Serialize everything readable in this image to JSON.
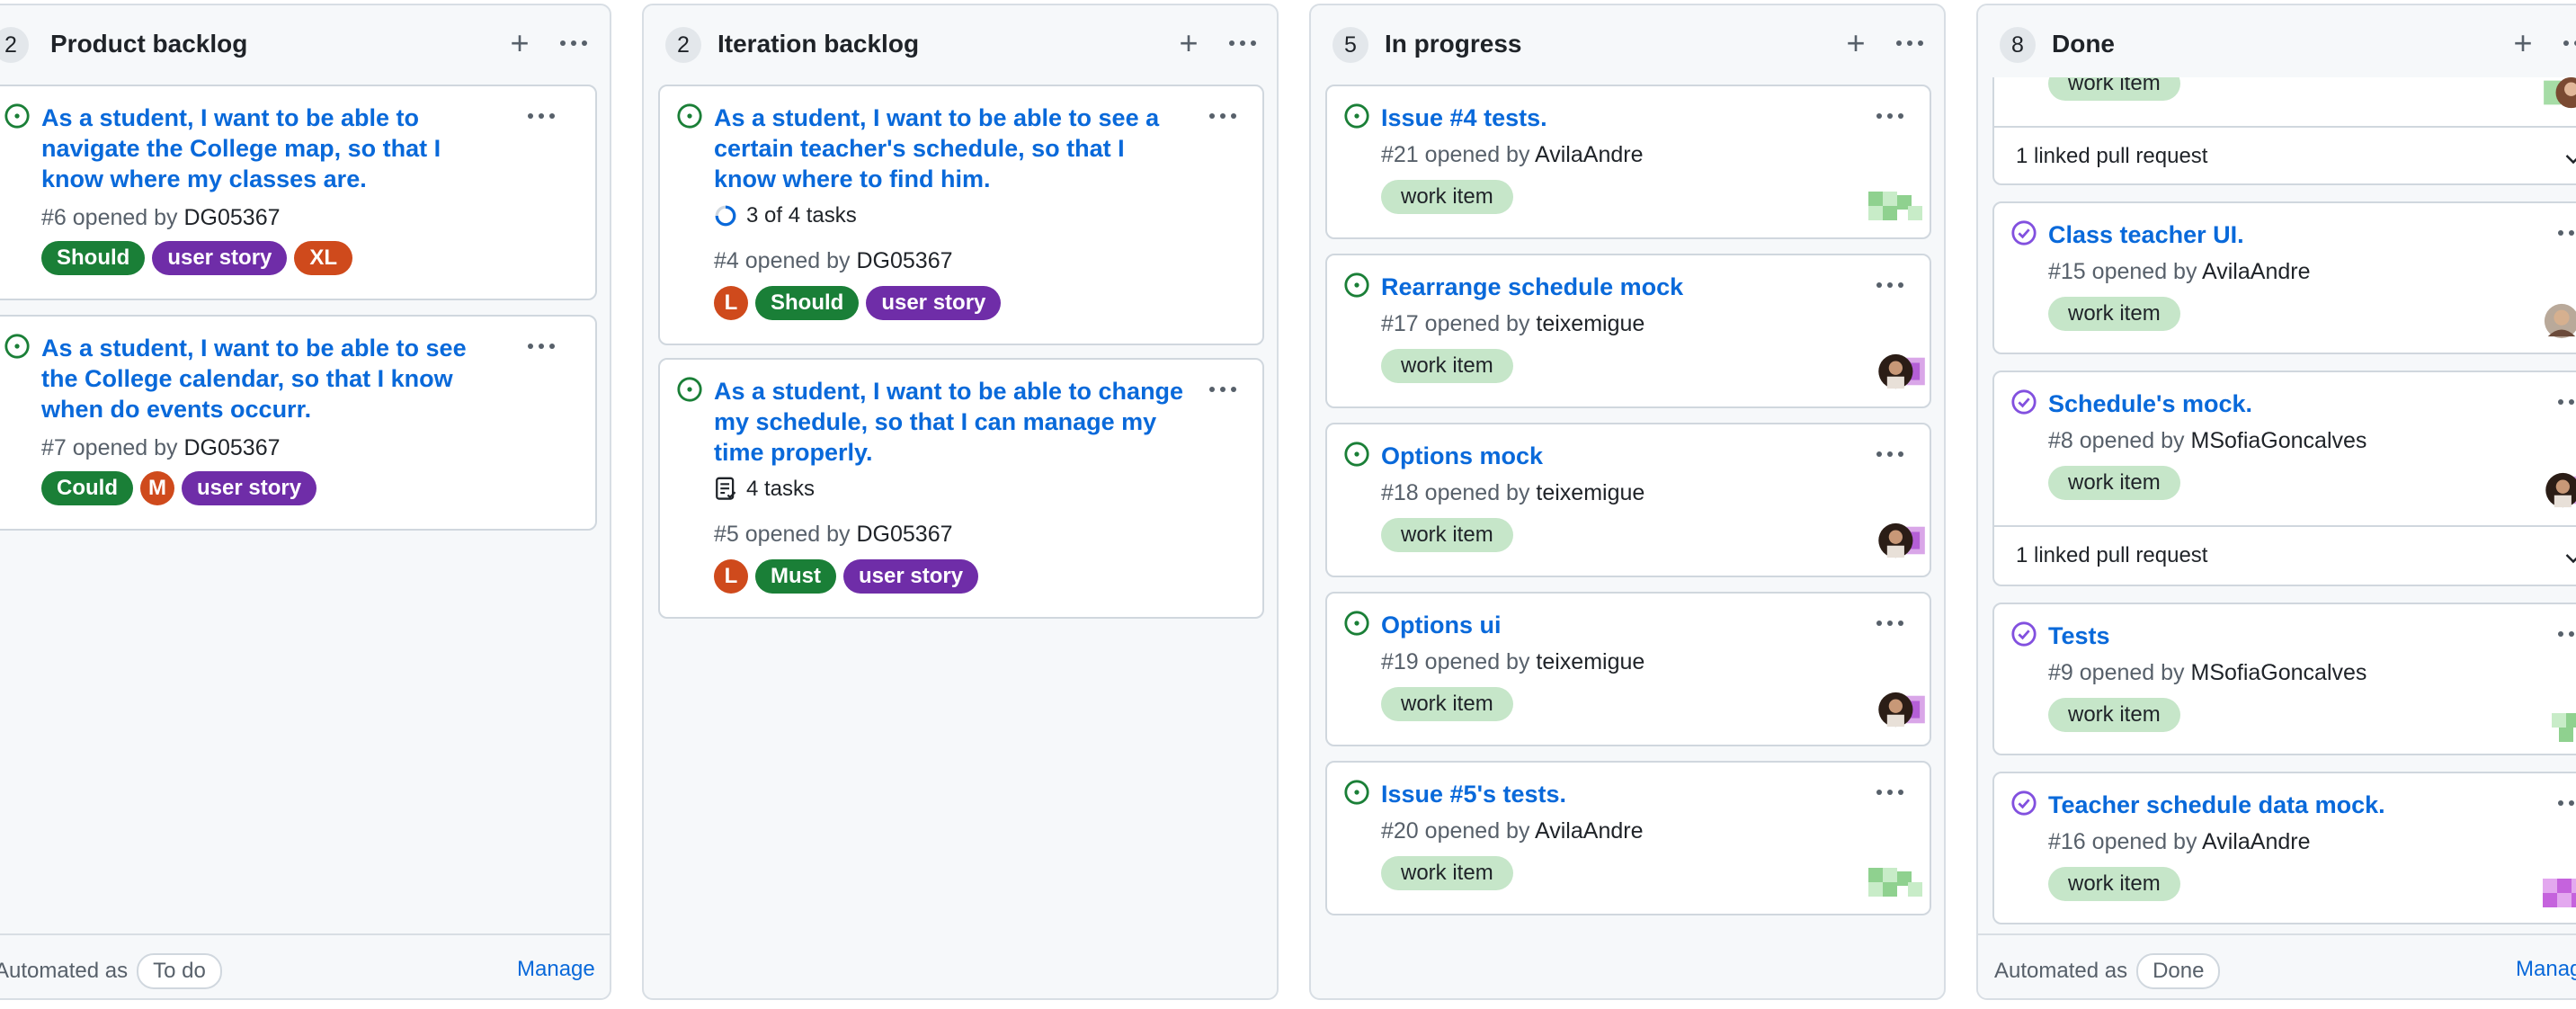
{
  "columns": [
    {
      "count": "2",
      "title": "Product backlog",
      "footer": {
        "automated_label": "Automated as",
        "status": "To do",
        "manage": "Manage"
      },
      "cards": [
        {
          "title": "As a student, I want to be able to navigate the College map, so that I know where my classes are.",
          "number": "#6",
          "opened_by": "opened by",
          "author": "DG05367",
          "labels": [
            "Should",
            "user story",
            "XL"
          ]
        },
        {
          "title": "As a student, I want to be able to see the College calendar, so that I know when do events occurr.",
          "number": "#7",
          "opened_by": "opened by",
          "author": "DG05367",
          "labels": [
            "Could",
            "M",
            "user story"
          ]
        }
      ]
    },
    {
      "count": "2",
      "title": "Iteration backlog",
      "cards": [
        {
          "title": "As a student, I want to be able to see a certain teacher's schedule, so that I know where to find him.",
          "tasks": "3 of 4 tasks",
          "number": "#4",
          "opened_by": "opened by",
          "author": "DG05367",
          "labels": [
            "L",
            "Should",
            "user story"
          ]
        },
        {
          "title": "As a student, I want to be able to change my schedule, so that I can manage my time properly.",
          "tasks": "4 tasks",
          "number": "#5",
          "opened_by": "opened by",
          "author": "DG05367",
          "labels": [
            "L",
            "Must",
            "user story"
          ]
        }
      ]
    },
    {
      "count": "5",
      "title": "In progress",
      "cards": [
        {
          "title": "Issue #4 tests.",
          "number": "#21",
          "opened_by": "opened by",
          "author": "AvilaAndre",
          "labels": [
            "work item"
          ]
        },
        {
          "title": "Rearrange schedule mock",
          "number": "#17",
          "opened_by": "opened by",
          "author": "teixemigue",
          "labels": [
            "work item"
          ]
        },
        {
          "title": "Options mock",
          "number": "#18",
          "opened_by": "opened by",
          "author": "teixemigue",
          "labels": [
            "work item"
          ]
        },
        {
          "title": "Options ui",
          "number": "#19",
          "opened_by": "opened by",
          "author": "teixemigue",
          "labels": [
            "work item"
          ]
        },
        {
          "title": "Issue #5's tests.",
          "number": "#20",
          "opened_by": "opened by",
          "author": "AvilaAndre",
          "labels": [
            "work item"
          ]
        }
      ]
    },
    {
      "count": "8",
      "title": "Done",
      "footer": {
        "automated_label": "Automated as",
        "status": "Done",
        "manage": "Manage"
      },
      "partial_card": {
        "labels": [
          "work item"
        ],
        "linked_pr": "1 linked pull request"
      },
      "cards": [
        {
          "title": "Class teacher UI.",
          "number": "#15",
          "opened_by": "opened by",
          "author": "AvilaAndre",
          "labels": [
            "work item"
          ]
        },
        {
          "title": "Schedule's mock.",
          "number": "#8",
          "opened_by": "opened by",
          "author": "MSofiaGoncalves",
          "labels": [
            "work item"
          ],
          "linked_pr": "1 linked pull request"
        },
        {
          "title": "Tests",
          "number": "#9",
          "opened_by": "opened by",
          "author": "MSofiaGoncalves",
          "labels": [
            "work item"
          ]
        },
        {
          "title": "Teacher schedule data mock.",
          "number": "#16",
          "opened_by": "opened by",
          "author": "AvilaAndre",
          "labels": [
            "work item"
          ]
        }
      ]
    }
  ],
  "label_colors": {
    "Should": "#1a7f37",
    "Could": "#1a7f37",
    "Must": "#1a7f37",
    "user story": "#6f2da8",
    "XL": "#cf4a1c",
    "M": "#cf4a1c",
    "L": "#cf4a1c",
    "work item": "#c6e6c9"
  },
  "colors": {
    "open_issue": "#1a7f37",
    "closed_issue": "#8250df",
    "link": "#0969da"
  }
}
